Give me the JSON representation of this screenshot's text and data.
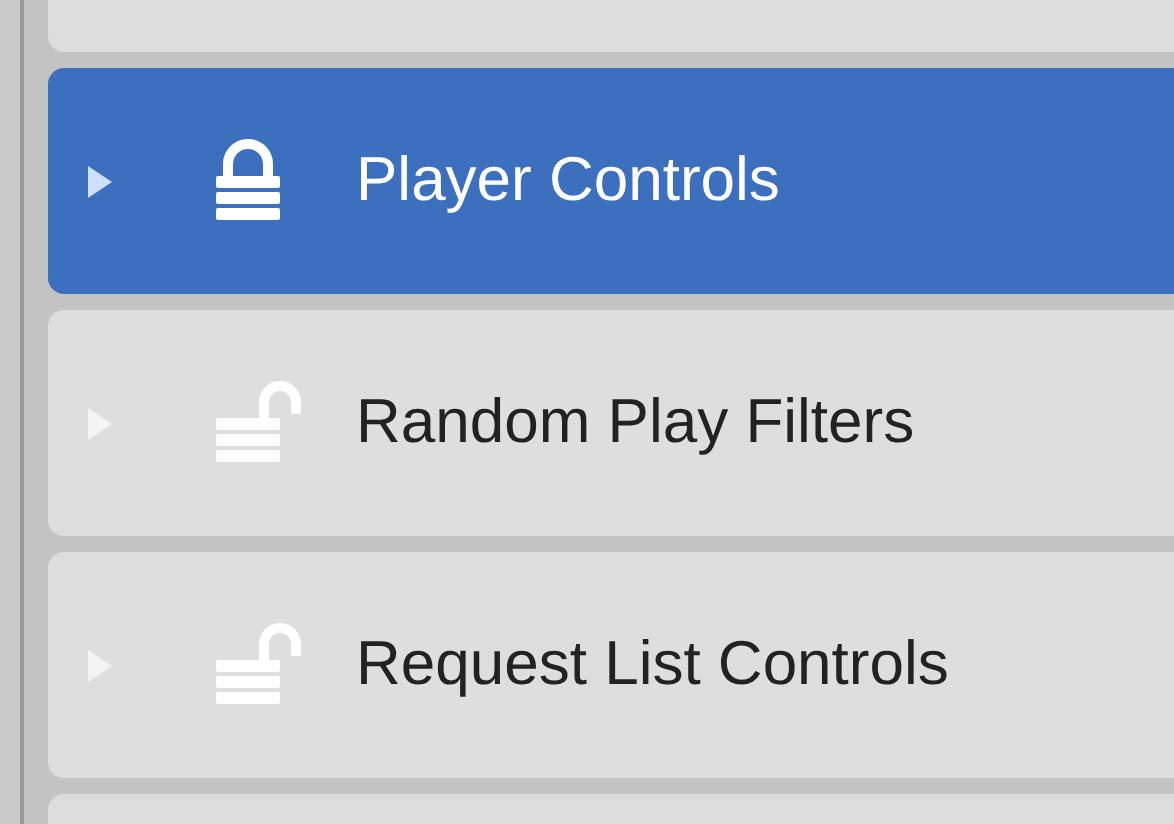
{
  "items": [
    {
      "label": "Player Controls",
      "selected": true,
      "locked": true
    },
    {
      "label": "Random Play Filters",
      "selected": false,
      "locked": false
    },
    {
      "label": "Request List Controls",
      "selected": false,
      "locked": false
    }
  ]
}
